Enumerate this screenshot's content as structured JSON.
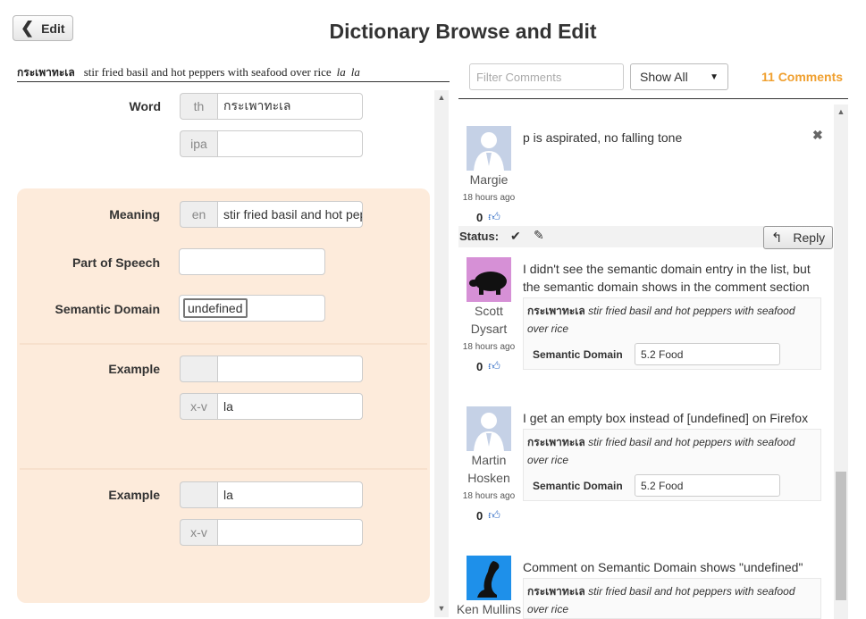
{
  "header": {
    "back_label": "Edit",
    "title": "Dictionary Browse and Edit"
  },
  "entry_summary": {
    "word": "กระเพาทะเล",
    "meaning": "stir fried basil and hot peppers with seafood over rice",
    "example1": "la",
    "example2": "la"
  },
  "word_section": {
    "label": "Word",
    "fields": [
      {
        "addon": "th",
        "value": "กระเพาทะเล"
      },
      {
        "addon": "ipa",
        "value": ""
      }
    ]
  },
  "sense_section": {
    "meaning_label": "Meaning",
    "meaning_addon": "en",
    "meaning_value": "stir fried basil and hot peppers with seafood over rice",
    "pos_label": "Part of Speech",
    "pos_value": "",
    "domain_label": "Semantic Domain",
    "domain_value": "undefined"
  },
  "examples": [
    {
      "label": "Example",
      "fields": [
        {
          "addon": "",
          "value": ""
        },
        {
          "addon": "x-v",
          "value": "la"
        }
      ]
    },
    {
      "label": "Example",
      "fields": [
        {
          "addon": "",
          "value": "la"
        },
        {
          "addon": "x-v",
          "value": ""
        }
      ]
    }
  ],
  "comments_panel": {
    "filter_placeholder": "Filter Comments",
    "show_select": "Show All",
    "count_label": "11 Comments",
    "status_label": "Status:",
    "reply_label": "Reply",
    "comments": [
      {
        "author": "Margie",
        "ago": "18 hours ago",
        "likes": "0",
        "text": "p is aspirated, no falling tone"
      },
      {
        "author": "Scott Dysart",
        "ago": "18 hours ago",
        "likes": "0",
        "text": "I didn't see the semantic domain entry in the list, but the semantic domain shows in the comment section",
        "ctx_word": "กระเพาทะเล",
        "ctx_meaning": "stir fried basil and hot peppers with seafood over rice",
        "ctx_field_label": "Semantic Domain",
        "ctx_field_value": "5.2 Food"
      },
      {
        "author": "Martin Hosken",
        "ago": "18 hours ago",
        "likes": "0",
        "text": "I get an empty box instead of [undefined] on Firefox",
        "ctx_word": "กระเพาทะเล",
        "ctx_meaning": "stir fried basil and hot peppers with seafood over rice",
        "ctx_field_label": "Semantic Domain",
        "ctx_field_value": "5.2 Food"
      },
      {
        "author": "Ken Mullins",
        "text": "Comment on Semantic Domain shows \"undefined\"",
        "ctx_word": "กระเพาทะเล",
        "ctx_meaning": "stir fried basil and hot peppers with seafood over rice"
      }
    ]
  },
  "icons": {
    "back": "chevron-left-icon",
    "close": "close-icon",
    "like": "thumbs-up-icon",
    "check": "check-icon",
    "edit": "edit-icon",
    "reply": "reply-icon"
  },
  "colors": {
    "card_bg": "#fdebdb",
    "count_accent": "#f0a030",
    "like_blue": "#1f5fbf"
  }
}
